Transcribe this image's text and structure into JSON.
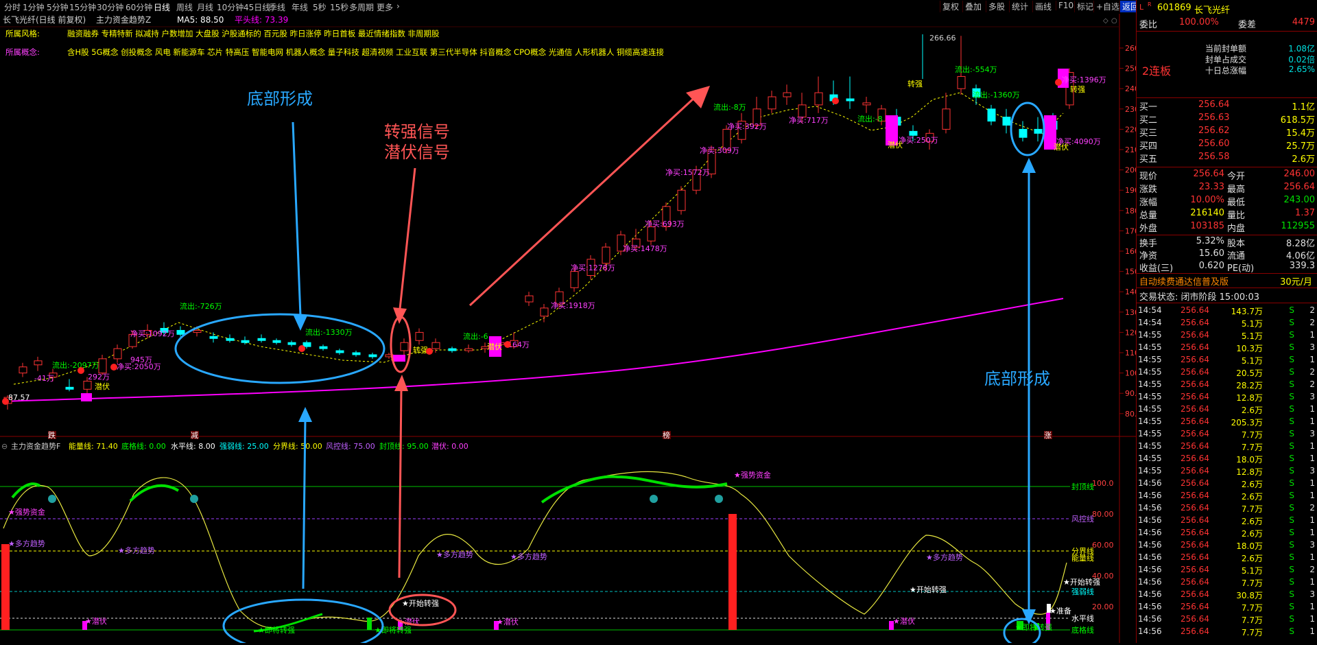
{
  "toolbar": {
    "timeframes": [
      "分时",
      "1分钟",
      "5分钟",
      "15分钟",
      "30分钟",
      "60分钟",
      "日线",
      "周线",
      "月线",
      "10分钟",
      "45日线",
      "季线",
      "年线",
      "5秒",
      "15秒",
      "多周期",
      "更多"
    ],
    "active": "日线",
    "right_tools": [
      "复权",
      "叠加",
      "多股",
      "统计",
      "画线",
      "F10",
      "标记",
      "+自选",
      "返回"
    ]
  },
  "chart_header": {
    "title": "长飞光纤(日线 前复权)",
    "indicator": "主力资金趋势Z",
    "ma5": "MA5: 88.50",
    "pingtou": "平头线: 73.39"
  },
  "style_line": {
    "label": "所属风格:",
    "text": "融资融券 专精特新 拟减持 户数增加 大盘股 沪股通标的 百元股 昨日涨停 昨日首板 最近情绪指数 非周期股"
  },
  "concept_line": {
    "label": "所属概念:",
    "text": "含H股 5G概念 创投概念 风电 新能源车 芯片 特高压 智能电网 机器人概念 量子科技 超清视频 工业互联 第三代半导体 抖音概念 CPO概念 光通信 人形机器人 铜缆高速连接"
  },
  "annotations": {
    "bottom_left": "底部形成",
    "signal_1": "转强信号",
    "signal_2": "潜伏信号",
    "bottom_right": "底部形成"
  },
  "price_axis": [
    "260.0",
    "250.0",
    "240.0",
    "230.0",
    "220.0",
    "210.0",
    "200.0",
    "190.0",
    "180.0",
    "170.0",
    "160.0",
    "150.0",
    "140.0",
    "130.0",
    "120.0",
    "110.0",
    "100.0",
    "90.00",
    "80.00"
  ],
  "peak_label": "266.66",
  "price_labels": [
    "87.57",
    "流出:-2097万",
    "-41万",
    "292万",
    "潜伏",
    "净买:2050万",
    "945万",
    "流出:-726万",
    "净买:1092万",
    "流出:-1330万",
    "转强",
    "流出:-6",
    "164万",
    "潜伏",
    "净买:1918万",
    "净买:1278万",
    "净买:1478万",
    "净买:693万",
    "净买:1572万",
    "净买:309万",
    "流出:-8万",
    "净买:392万",
    "净买:717万",
    "流出:-8",
    "净买:250万",
    "潜伏",
    "流出:-554万",
    "转强",
    "流出:-1360万",
    "净买:1396万",
    "转强",
    "净买:4090万",
    "潜伏"
  ],
  "date_markers": [
    "跌",
    "减",
    "榜",
    "涨"
  ],
  "indicator_header": {
    "name": "主力资金趋势F",
    "nengliang": "能量线: 71.40",
    "digexian": "底格线: 0.00",
    "shuiping": "水平线: 8.00",
    "qiangruo": "强弱线: 25.00",
    "fenjie": "分界线: 50.00",
    "fengkong": "风控线: 75.00",
    "fengding": "封顶线: 95.00",
    "qianfu": "潜伏: 0.00"
  },
  "indicator_axis": [
    "100.0",
    "80.00",
    "60.00",
    "40.00",
    "20.00"
  ],
  "indicator_lines": [
    "封顶线",
    "风控线",
    "分界线",
    "能量线",
    "强弱线",
    "水平线",
    "底格线"
  ],
  "indicator_labels": [
    "强势资金",
    "多方趋势",
    "多方趋势",
    "即将转强",
    "即将转强",
    "潜伏",
    "潜伏",
    "潜伏",
    "开始转强",
    "多方趋势",
    "多方趋势",
    "强势资金",
    "开始转强",
    "多方趋势",
    "潜伏",
    "准备",
    "即将转强",
    "开始转强"
  ],
  "panel": {
    "code": "601869",
    "name": "长飞光纤",
    "weibi_label": "委比",
    "weibi_val": "100.00%",
    "weicha_label": "委差",
    "weicha_val": "4479",
    "lianban": "2连板",
    "board_info": [
      {
        "k": "当前封单额",
        "v": "1.08亿"
      },
      {
        "k": "封单占成交",
        "v": "0.02倍"
      },
      {
        "k": "十日总涨幅",
        "v": "2.65%"
      }
    ],
    "bids": [
      {
        "name": "买一",
        "price": "256.64",
        "vol": "1.1亿"
      },
      {
        "name": "买二",
        "price": "256.63",
        "vol": "618.5万"
      },
      {
        "name": "买三",
        "price": "256.62",
        "vol": "15.4万"
      },
      {
        "name": "买四",
        "price": "256.60",
        "vol": "25.7万"
      },
      {
        "name": "买五",
        "price": "256.58",
        "vol": "2.6万"
      }
    ],
    "quote": [
      {
        "k1": "现价",
        "v1": "256.64",
        "k2": "今开",
        "v2": "246.00"
      },
      {
        "k1": "涨跌",
        "v1": "23.33",
        "k2": "最高",
        "v2": "256.64"
      },
      {
        "k1": "涨幅",
        "v1": "10.00%",
        "k2": "最低",
        "v2": "243.00"
      },
      {
        "k1": "总量",
        "v1": "216140",
        "k2": "量比",
        "v2": "1.37"
      },
      {
        "k1": "外盘",
        "v1": "103185",
        "k2": "内盘",
        "v2": "112955"
      }
    ],
    "finance": [
      {
        "k1": "换手",
        "v1": "5.32%",
        "k2": "股本",
        "v2": "8.28亿"
      },
      {
        "k1": "净资",
        "v1": "15.60",
        "k2": "流通",
        "v2": "4.06亿"
      },
      {
        "k1": "收益(三)",
        "v1": "0.620",
        "k2": "PE(动)",
        "v2": "339.3"
      }
    ],
    "promo": "自动续费通达信普及版",
    "promo_price": "30元/月",
    "trade_state": "交易状态: 闭市阶段 15:00:03",
    "ticks": [
      {
        "t": "14:54",
        "p": "256.64",
        "v": "143.7万",
        "s": "S",
        "n": "2"
      },
      {
        "t": "14:54",
        "p": "256.64",
        "v": "5.1万",
        "s": "S",
        "n": "2"
      },
      {
        "t": "14:55",
        "p": "256.64",
        "v": "5.1万",
        "s": "S",
        "n": "1"
      },
      {
        "t": "14:55",
        "p": "256.64",
        "v": "10.3万",
        "s": "S",
        "n": "3"
      },
      {
        "t": "14:55",
        "p": "256.64",
        "v": "5.1万",
        "s": "S",
        "n": "1"
      },
      {
        "t": "14:55",
        "p": "256.64",
        "v": "20.5万",
        "s": "S",
        "n": "2"
      },
      {
        "t": "14:55",
        "p": "256.64",
        "v": "28.2万",
        "s": "S",
        "n": "2"
      },
      {
        "t": "14:55",
        "p": "256.64",
        "v": "12.8万",
        "s": "S",
        "n": "3"
      },
      {
        "t": "14:55",
        "p": "256.64",
        "v": "2.6万",
        "s": "S",
        "n": "1"
      },
      {
        "t": "14:55",
        "p": "256.64",
        "v": "205.3万",
        "s": "S",
        "n": "1"
      },
      {
        "t": "14:55",
        "p": "256.64",
        "v": "7.7万",
        "s": "S",
        "n": "3"
      },
      {
        "t": "14:55",
        "p": "256.64",
        "v": "7.7万",
        "s": "S",
        "n": "1"
      },
      {
        "t": "14:55",
        "p": "256.64",
        "v": "18.0万",
        "s": "S",
        "n": "1"
      },
      {
        "t": "14:55",
        "p": "256.64",
        "v": "12.8万",
        "s": "S",
        "n": "3"
      },
      {
        "t": "14:56",
        "p": "256.64",
        "v": "2.6万",
        "s": "S",
        "n": "1"
      },
      {
        "t": "14:56",
        "p": "256.64",
        "v": "2.6万",
        "s": "S",
        "n": "1"
      },
      {
        "t": "14:56",
        "p": "256.64",
        "v": "7.7万",
        "s": "S",
        "n": "2"
      },
      {
        "t": "14:56",
        "p": "256.64",
        "v": "2.6万",
        "s": "S",
        "n": "1"
      },
      {
        "t": "14:56",
        "p": "256.64",
        "v": "2.6万",
        "s": "S",
        "n": "1"
      },
      {
        "t": "14:56",
        "p": "256.64",
        "v": "18.0万",
        "s": "S",
        "n": "3"
      },
      {
        "t": "14:56",
        "p": "256.64",
        "v": "2.6万",
        "s": "S",
        "n": "1"
      },
      {
        "t": "14:56",
        "p": "256.64",
        "v": "5.1万",
        "s": "S",
        "n": "2"
      },
      {
        "t": "14:56",
        "p": "256.64",
        "v": "7.7万",
        "s": "S",
        "n": "1"
      },
      {
        "t": "14:56",
        "p": "256.64",
        "v": "30.8万",
        "s": "S",
        "n": "3"
      },
      {
        "t": "14:56",
        "p": "256.64",
        "v": "7.7万",
        "s": "S",
        "n": "1"
      },
      {
        "t": "14:56",
        "p": "256.64",
        "v": "7.7万",
        "s": "S",
        "n": "1"
      },
      {
        "t": "14:56",
        "p": "256.64",
        "v": "7.7万",
        "s": "S",
        "n": "1"
      }
    ]
  },
  "colors": {
    "up": "#ff3333",
    "down": "#00ffff",
    "ma_purple": "#ff00ff",
    "energy": "#ffff00",
    "annotation_blue": "#29a8ff",
    "annotation_red": "#ff5555"
  }
}
